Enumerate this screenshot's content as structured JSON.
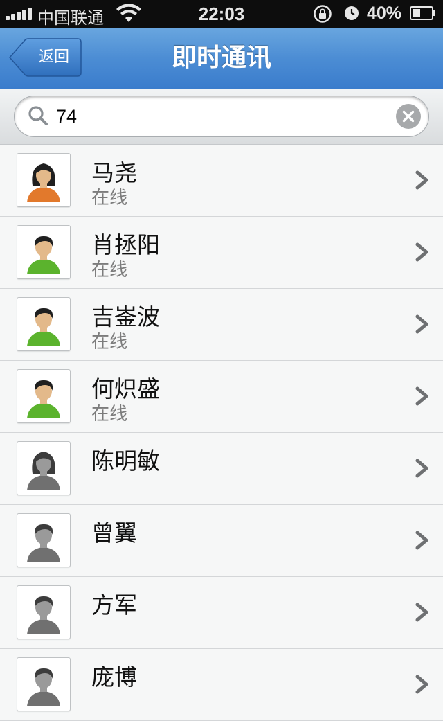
{
  "status_bar": {
    "carrier": "中国联通",
    "time": "22:03",
    "battery": "40%"
  },
  "nav": {
    "back_label": "返回",
    "title": "即时通讯"
  },
  "search": {
    "value": "74"
  },
  "contacts": [
    {
      "name": "马尧",
      "status": "在线",
      "avatar": "female-online"
    },
    {
      "name": "肖拯阳",
      "status": "在线",
      "avatar": "male-online"
    },
    {
      "name": "吉崟波",
      "status": "在线",
      "avatar": "male-online"
    },
    {
      "name": "何炽盛",
      "status": "在线",
      "avatar": "male-online"
    },
    {
      "name": "陈明敏",
      "status": "",
      "avatar": "female-offline"
    },
    {
      "name": "曾翼",
      "status": "",
      "avatar": "male-offline"
    },
    {
      "name": "方军",
      "status": "",
      "avatar": "male-offline"
    },
    {
      "name": "庞博",
      "status": "",
      "avatar": "male-offline"
    }
  ],
  "colors": {
    "nav_blue": "#4c8dd4",
    "online_female_shirt": "#e2792c",
    "online_male_shirt": "#5bb32d",
    "offline_shirt": "#707070"
  }
}
